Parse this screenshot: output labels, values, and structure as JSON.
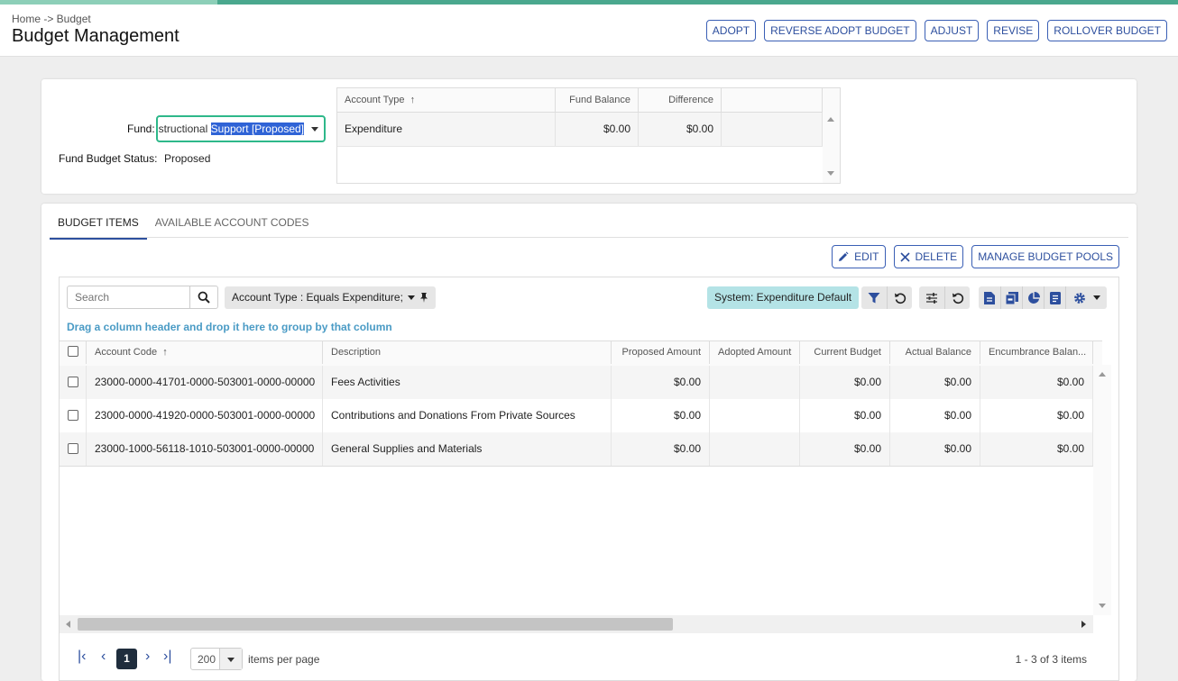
{
  "header": {
    "breadcrumb": "Home -> Budget",
    "title": "Budget Management",
    "buttons": [
      "ADOPT",
      "REVERSE ADOPT BUDGET",
      "ADJUST",
      "REVISE",
      "ROLLOVER BUDGET"
    ]
  },
  "fund": {
    "label": "Fund:",
    "value_prefix": "nstructional ",
    "value_selected": "Support [Proposed]",
    "status_label": "Fund Budget Status:",
    "status_value": "Proposed"
  },
  "summary_grid": {
    "columns": [
      "Account Type",
      "Fund Balance",
      "Difference"
    ],
    "sort_icon": "↑",
    "rows": [
      {
        "account_type": "Expenditure",
        "fund_balance": "$0.00",
        "difference": "$0.00"
      }
    ]
  },
  "tabs": [
    "BUDGET ITEMS",
    "AVAILABLE ACCOUNT CODES"
  ],
  "actions": {
    "edit": "EDIT",
    "delete": "DELETE",
    "manage": "MANAGE BUDGET POOLS"
  },
  "toolbar": {
    "search_placeholder": "Search",
    "filter_chip": "Account Type : Equals Expenditure;",
    "system_view": "System: Expenditure Default",
    "drag_tip": "Drag a column header and drop it here to group by that column"
  },
  "items_grid": {
    "columns": [
      "Account Code",
      "Description",
      "Proposed Amount",
      "Adopted Amount",
      "Current Budget",
      "Actual Balance",
      "Encumbrance Balan..."
    ],
    "sort_icon": "↑",
    "rows": [
      {
        "code": "23000-0000-41701-0000-503001-0000-00000",
        "description": "Fees Activities",
        "proposed": "$0.00",
        "adopted": "",
        "current": "$0.00",
        "actual": "$0.00",
        "encumbrance": "$0.00"
      },
      {
        "code": "23000-0000-41920-0000-503001-0000-00000",
        "description": "Contributions and Donations From Private Sources",
        "proposed": "$0.00",
        "adopted": "",
        "current": "$0.00",
        "actual": "$0.00",
        "encumbrance": "$0.00"
      },
      {
        "code": "23000-1000-56118-1010-503001-0000-00000",
        "description": "General Supplies and Materials",
        "proposed": "$0.00",
        "adopted": "",
        "current": "$0.00",
        "actual": "$0.00",
        "encumbrance": "$0.00"
      }
    ]
  },
  "pager": {
    "current_page": "1",
    "page_size": "200",
    "page_size_label": "items per page",
    "info": "1 - 3 of 3 items",
    "first": "|‹",
    "prev": "‹",
    "next": "›",
    "last": "›|"
  },
  "colors": {
    "accent": "#2d4f9e",
    "focus": "#2eb88a",
    "system_chip": "#b4e3e6",
    "topbar": "#4aa88e"
  }
}
